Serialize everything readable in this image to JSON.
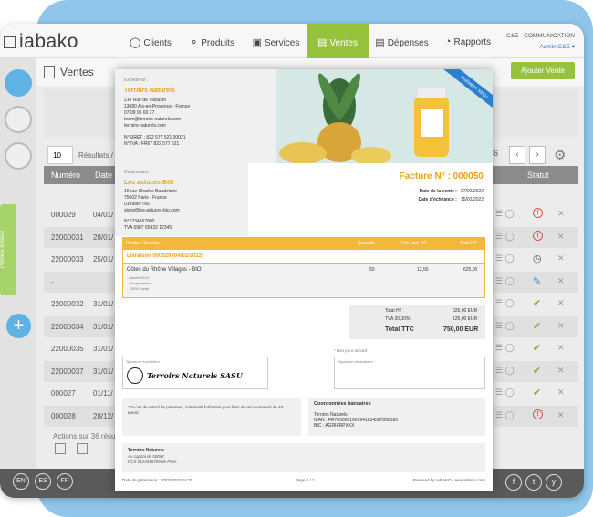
{
  "app": {
    "logo": "iabako",
    "company": "C&E - COMMUNICATION",
    "user": "Admin C&E"
  },
  "nav": [
    {
      "label": "Clients",
      "icon": "person-icon"
    },
    {
      "label": "Produits",
      "icon": "tag-icon"
    },
    {
      "label": "Services",
      "icon": "briefcase-icon"
    },
    {
      "label": "Ventes",
      "icon": "cart-icon"
    },
    {
      "label": "Dépenses",
      "icon": "receipt-icon"
    },
    {
      "label": "Rapports",
      "icon": "chart-icon"
    }
  ],
  "page": {
    "title": "Ventes",
    "add_label": "Ajouter Vente",
    "per_page": "10",
    "results_text": "Résultats / P",
    "page_count": "36",
    "sidebar_tab": "Période d'essai",
    "actions_text": "Actions sur 36 résult"
  },
  "table": {
    "headers": [
      "Numéro",
      "Date v",
      "Statut"
    ],
    "rows": [
      {
        "num": "000029",
        "date": "04/01/",
        "status": "alert"
      },
      {
        "num": "22000031",
        "date": "28/01/",
        "status": "alert"
      },
      {
        "num": "22000033",
        "date": "25/01/",
        "status": "clock"
      },
      {
        "num": "-",
        "date": "",
        "status": "edit"
      },
      {
        "num": "22000032",
        "date": "31/01/",
        "status": "check"
      },
      {
        "num": "22000034",
        "date": "31/01/",
        "status": "check"
      },
      {
        "num": "22000035",
        "date": "31/01/",
        "status": "check"
      },
      {
        "num": "22000037",
        "date": "31/01/",
        "status": "check"
      },
      {
        "num": "000027",
        "date": "01/11/",
        "status": "check"
      },
      {
        "num": "000028",
        "date": "28/12/",
        "status": "alert"
      }
    ]
  },
  "footer": {
    "langs": [
      "EN",
      "ES",
      "FR"
    ],
    "social": [
      "f",
      "t",
      "y"
    ]
  },
  "invoice": {
    "exp_label": "Expéditeur :",
    "exp_name": "Terroirs Naturels",
    "exp_lines": [
      "210 Rue de Villouxel",
      "13080 Aix-en-Provence - France",
      "07 09 06 60 27",
      "team@terroirs-naturels.com",
      "terroirs-naturels.com"
    ],
    "exp_ids": [
      "N°SIRET : 822 577 521 00021",
      "N°TVA : FR67 822 577 521"
    ],
    "ribbon": "PAIEMENT REÇU",
    "dest_label": "Destinataire :",
    "dest_name": "Les astuces BIO",
    "dest_lines": [
      "16 rue Charles Baudelaire",
      "75002 Paris - France",
      "0199887766",
      "store@les-astuces-bio.com"
    ],
    "dest_ids": [
      "N°1234567890",
      "TVA 0987 65432 12345"
    ],
    "facture": "Facture N° : 000050",
    "date_vente_label": "Date de la vente :",
    "date_vente": "07/02/2022",
    "date_ech_label": "Date d'échéance :",
    "date_ech": "15/02/2022",
    "cols": [
      "Produit / Service",
      "Quantité",
      "Prix unit. HT",
      "Total HT"
    ],
    "livraison": "Livraison 000029 (04/02/2022)",
    "product": "Côtes du Rhône Villages - BIO",
    "product_sub": [
      "- Année 2019",
      "- Biodynamique",
      "- 100% Syrah"
    ],
    "qty": "50",
    "unit": "12,50",
    "total": "625,00",
    "totals": [
      {
        "label": "Total HT",
        "value": "625,00 EUR"
      },
      {
        "label": "TVA 20,00%",
        "value": "125,00 EUR"
      },
      {
        "label": "Total TTC",
        "value": "750,00 EUR"
      }
    ],
    "sig_exp_label": "Signature expéditeur :",
    "stamp_text": "Terroirs Naturels SASU",
    "bon_accord": "* Bon pour accord",
    "sig_dest_label": "Signature destinataire :",
    "late_text": "\"En cas de retard de paiement, indemnité forfaitaire pour frais de recouvrement de 40 euros.\"",
    "bank_title": "Coordonnées bancaires",
    "bank_name": "Terroirs Naturels",
    "iban": "IBAN : FR7630001007941234567890185",
    "bic": "BIC : AGRIFRPXXX",
    "company_name": "Terroirs Naturels",
    "capital": "Au capital de 5000€",
    "rcs": "RCS 0123456789 de Paris",
    "gen_date": "Date de génération : 07/02/2022 14:21",
    "page": "Page 1 / 1",
    "powered": "Powered by IABAKO | www.iabako.com"
  },
  "colors": {
    "accent_green": "#97c23c",
    "blue": "#5fb2e4",
    "orange": "#e8a21a",
    "background": "#8fc6ea"
  }
}
